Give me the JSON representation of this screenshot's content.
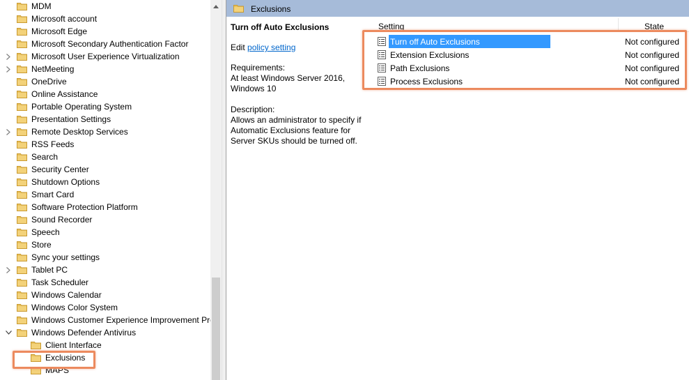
{
  "tree": {
    "items": [
      {
        "label": "MDM",
        "level": 0,
        "expander": "none"
      },
      {
        "label": "Microsoft account",
        "level": 0,
        "expander": "none"
      },
      {
        "label": "Microsoft Edge",
        "level": 0,
        "expander": "none"
      },
      {
        "label": "Microsoft Secondary Authentication Factor",
        "level": 0,
        "expander": "none"
      },
      {
        "label": "Microsoft User Experience Virtualization",
        "level": 0,
        "expander": "collapsed"
      },
      {
        "label": "NetMeeting",
        "level": 0,
        "expander": "collapsed"
      },
      {
        "label": "OneDrive",
        "level": 0,
        "expander": "none"
      },
      {
        "label": "Online Assistance",
        "level": 0,
        "expander": "none"
      },
      {
        "label": "Portable Operating System",
        "level": 0,
        "expander": "none"
      },
      {
        "label": "Presentation Settings",
        "level": 0,
        "expander": "none"
      },
      {
        "label": "Remote Desktop Services",
        "level": 0,
        "expander": "collapsed"
      },
      {
        "label": "RSS Feeds",
        "level": 0,
        "expander": "none"
      },
      {
        "label": "Search",
        "level": 0,
        "expander": "none"
      },
      {
        "label": "Security Center",
        "level": 0,
        "expander": "none"
      },
      {
        "label": "Shutdown Options",
        "level": 0,
        "expander": "none"
      },
      {
        "label": "Smart Card",
        "level": 0,
        "expander": "none"
      },
      {
        "label": "Software Protection Platform",
        "level": 0,
        "expander": "none"
      },
      {
        "label": "Sound Recorder",
        "level": 0,
        "expander": "none"
      },
      {
        "label": "Speech",
        "level": 0,
        "expander": "none"
      },
      {
        "label": "Store",
        "level": 0,
        "expander": "none"
      },
      {
        "label": "Sync your settings",
        "level": 0,
        "expander": "none"
      },
      {
        "label": "Tablet PC",
        "level": 0,
        "expander": "collapsed"
      },
      {
        "label": "Task Scheduler",
        "level": 0,
        "expander": "none"
      },
      {
        "label": "Windows Calendar",
        "level": 0,
        "expander": "none"
      },
      {
        "label": "Windows Color System",
        "level": 0,
        "expander": "none"
      },
      {
        "label": "Windows Customer Experience Improvement Pro",
        "level": 0,
        "expander": "none"
      },
      {
        "label": "Windows Defender Antivirus",
        "level": 0,
        "expander": "expanded"
      },
      {
        "label": "Client Interface",
        "level": 1,
        "expander": "none"
      },
      {
        "label": "Exclusions",
        "level": 1,
        "expander": "none",
        "selected": true
      },
      {
        "label": "MAPS",
        "level": 1,
        "expander": "none"
      }
    ]
  },
  "header": {
    "title": "Exclusions"
  },
  "description": {
    "heading": "Turn off Auto Exclusions",
    "edit_prefix": "Edit ",
    "edit_link": "policy setting",
    "requirements_label": "Requirements:",
    "requirements_text": "At least Windows Server 2016, Windows 10",
    "description_label": "Description:",
    "description_text": "Allows an administrator to specify if Automatic Exclusions feature for Server SKUs should be turned off."
  },
  "list": {
    "columns": {
      "setting": "Setting",
      "state": "State"
    },
    "rows": [
      {
        "name": "Turn off Auto Exclusions",
        "state": "Not configured",
        "selected": true
      },
      {
        "name": "Extension Exclusions",
        "state": "Not configured",
        "selected": false
      },
      {
        "name": "Path Exclusions",
        "state": "Not configured",
        "selected": false
      },
      {
        "name": "Process Exclusions",
        "state": "Not configured",
        "selected": false
      }
    ]
  },
  "colors": {
    "folder": "#e8c15c",
    "folder_dark": "#d1a43a",
    "header_bg": "#a6bbd9",
    "selection": "#3399ff",
    "highlight": "#ec8a5e",
    "link": "#0066cc"
  },
  "icons": {
    "folder": "folder-icon",
    "policy_doc": "policy-document-icon",
    "chevron_right": "chevron-right-icon",
    "chevron_down": "chevron-down-icon",
    "scroll_up": "scroll-up-arrow-icon"
  }
}
